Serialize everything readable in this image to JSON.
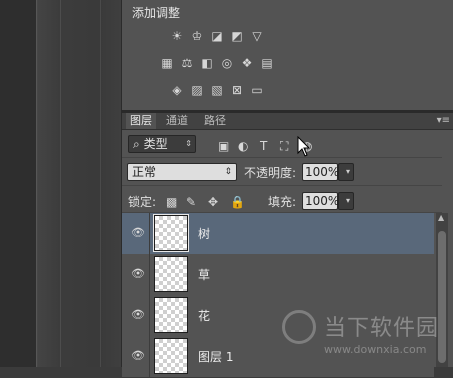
{
  "adjustments": {
    "title": "添加调整",
    "row1": [
      {
        "icon": "brightness-contrast-icon",
        "glyph": "☀"
      },
      {
        "icon": "levels-icon",
        "glyph": "♔"
      },
      {
        "icon": "curves-icon",
        "glyph": "◪"
      },
      {
        "icon": "exposure-icon",
        "glyph": "◩"
      },
      {
        "icon": "vibrance-icon",
        "glyph": "▽"
      }
    ],
    "row2": [
      {
        "icon": "hue-saturation-icon",
        "glyph": "▦"
      },
      {
        "icon": "color-balance-icon",
        "glyph": "⚖"
      },
      {
        "icon": "black-white-icon",
        "glyph": "◧"
      },
      {
        "icon": "photo-filter-icon",
        "glyph": "◎"
      },
      {
        "icon": "channel-mixer-icon",
        "glyph": "❖"
      },
      {
        "icon": "color-lookup-icon",
        "glyph": "▤"
      }
    ],
    "row3": [
      {
        "icon": "invert-icon",
        "glyph": "◈"
      },
      {
        "icon": "posterize-icon",
        "glyph": "▨"
      },
      {
        "icon": "threshold-icon",
        "glyph": "▧"
      },
      {
        "icon": "gradient-map-icon",
        "glyph": "⊠"
      },
      {
        "icon": "selective-color-icon",
        "glyph": "▭"
      }
    ]
  },
  "layers_panel": {
    "tabs": [
      "图层",
      "通道",
      "路径"
    ],
    "active_tab": "图层",
    "menu_glyph": "▾≡",
    "filter": {
      "search_glyph": "⌕",
      "kind_label": "类型",
      "arrow": "⇕"
    },
    "filter_icons": [
      {
        "icon": "pixel-filter-icon",
        "glyph": "▣"
      },
      {
        "icon": "adjustment-filter-icon",
        "glyph": "◐"
      },
      {
        "icon": "type-filter-icon",
        "glyph": "T"
      },
      {
        "icon": "shape-filter-icon",
        "glyph": "⛶"
      },
      {
        "icon": "smart-object-filter-icon",
        "glyph": "◍"
      }
    ],
    "blend_mode": "正常",
    "opacity_label": "不透明度:",
    "opacity_value": "100%",
    "lock_label": "锁定:",
    "lock_icons": [
      {
        "icon": "lock-transparency-icon",
        "glyph": "▩"
      },
      {
        "icon": "lock-image-icon",
        "glyph": "✎"
      },
      {
        "icon": "lock-position-icon",
        "glyph": "✥"
      },
      {
        "icon": "lock-all-icon",
        "glyph": "🔒"
      }
    ],
    "fill_label": "填充:",
    "fill_value": "100%",
    "dropdown_arrow": "▾",
    "layers": [
      {
        "name": "树",
        "selected": true
      },
      {
        "name": "草",
        "selected": false
      },
      {
        "name": "花",
        "selected": false
      },
      {
        "name": "图层 1",
        "selected": false
      }
    ],
    "eye_glyph": "👁",
    "scroll_up_glyph": "▲"
  },
  "watermark": {
    "title": "当下软件园",
    "url": "www.downxia.com"
  },
  "colors": {
    "panel_bg": "#535353",
    "selected_row": "#59687a",
    "field_light": "#dedede",
    "field_dark": "#3c3c3c"
  }
}
